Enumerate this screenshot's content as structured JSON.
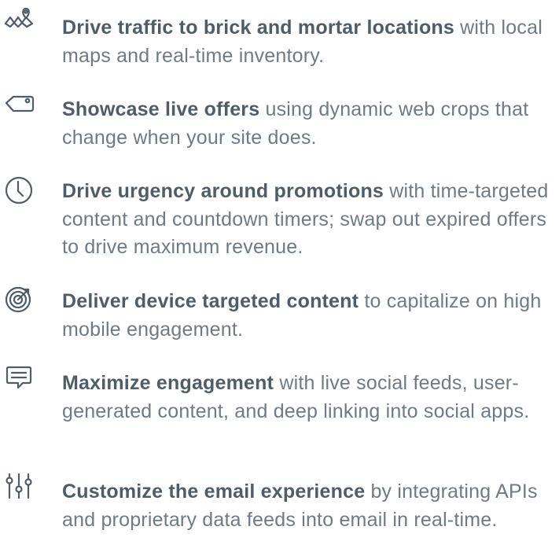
{
  "colors": {
    "icon": "#4f5d69",
    "headline": "#4f5d69",
    "body": "#6e7b86",
    "background": "#ffffff"
  },
  "features": [
    {
      "icon": "map-pin-icon",
      "headline": "Drive traffic to brick and mortar locations",
      "text": " with local maps and real-time inventory."
    },
    {
      "icon": "price-tag-icon",
      "headline": "Showcase live offers",
      "text": " using dynamic web crops that change when your site does."
    },
    {
      "icon": "clock-icon",
      "headline": "Drive urgency around promotions",
      "text": " with time-targeted content and countdown timers; swap out expired offers to drive maximum revenue."
    },
    {
      "icon": "target-icon",
      "headline": "Deliver device targeted content",
      "text": " to capitalize on high mobile engagement."
    },
    {
      "icon": "chat-bubble-icon",
      "headline": "Maximize engagement",
      "text": " with live social feeds, user-generated content, and deep linking into social apps."
    },
    {
      "icon": "sliders-icon",
      "headline": "Customize the email experience",
      "text": " by integrating APIs and proprietary data feeds into email in real-time."
    }
  ]
}
